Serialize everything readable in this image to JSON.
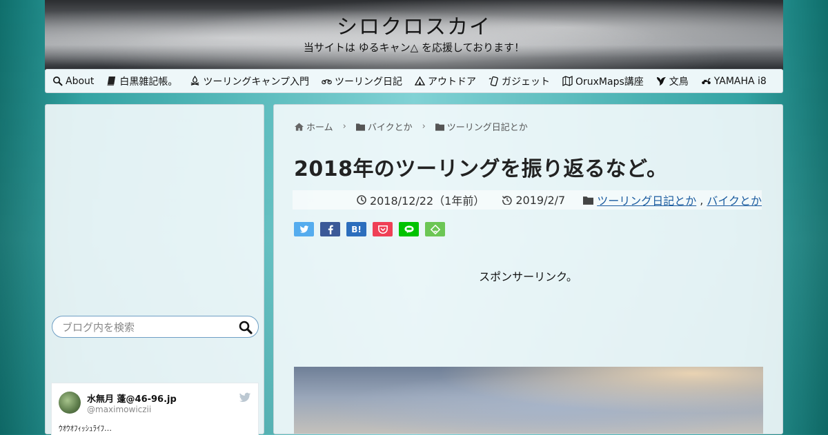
{
  "header": {
    "site_title": "シロクロスカイ",
    "tagline": "当サイトは ゆるキャン△ を応援しております！"
  },
  "nav": {
    "items": [
      {
        "label": "About",
        "icon": "search-icon"
      },
      {
        "label": "白黒雑記帳。",
        "icon": "book-icon"
      },
      {
        "label": "ツーリングキャンプ入門",
        "icon": "campfire-icon"
      },
      {
        "label": "ツーリング日記",
        "icon": "motorcycle-icon"
      },
      {
        "label": "アウトドア",
        "icon": "tent-icon"
      },
      {
        "label": "ガジェット",
        "icon": "phone-icon"
      },
      {
        "label": "OruxMaps講座",
        "icon": "map-icon"
      },
      {
        "label": "文鳥",
        "icon": "bird-icon"
      },
      {
        "label": "YAMAHA i8",
        "icon": "scooter-icon"
      }
    ]
  },
  "sidebar": {
    "search_placeholder": "ブログ内を検索",
    "tweet": {
      "name": "水無月 蓬@46-96.jp",
      "handle": "@maximowiczii",
      "text": "ｳｵｳｵﾌｨｯｼｭﾗｲﾌ…"
    }
  },
  "breadcrumb": {
    "home": "ホーム",
    "category1": "バイクとか",
    "category2": "ツーリング日記とか",
    "separator": "›"
  },
  "post": {
    "title": "2018年のツーリングを振り返るなど。",
    "published": "2018/12/22（1年前）",
    "updated": "2019/2/7",
    "category_link1": "ツーリング日記とか",
    "category_sep": ",",
    "category_link2": "バイクとか"
  },
  "share": {
    "buttons": [
      {
        "name": "twitter",
        "color": "#55acee"
      },
      {
        "name": "facebook",
        "color": "#3b5998"
      },
      {
        "name": "hatena",
        "color": "#2c6ebd",
        "label": "B!"
      },
      {
        "name": "pocket",
        "color": "#ef4056"
      },
      {
        "name": "line",
        "color": "#00c300"
      },
      {
        "name": "feedly",
        "color": "#6cc655"
      }
    ]
  },
  "sponsor_text": "スポンサーリンク。"
}
